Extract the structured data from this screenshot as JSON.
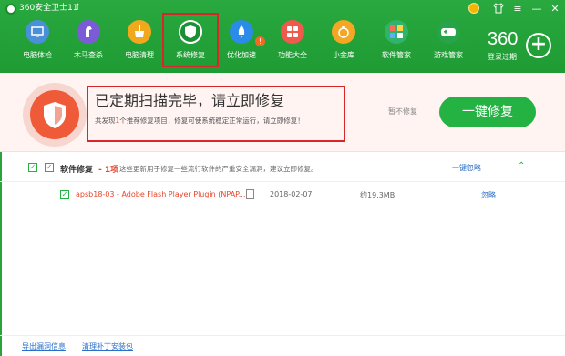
{
  "window": {
    "title": "360安全卫士11",
    "controls": [
      "shirt-icon",
      "menu-icon",
      "minimize-icon",
      "close-icon"
    ]
  },
  "nav": {
    "items": [
      {
        "label": "电脑体检",
        "icon": "monitor-icon",
        "color": "#4a90d9"
      },
      {
        "label": "木马查杀",
        "icon": "horse-icon",
        "color": "#7b5cd6"
      },
      {
        "label": "电脑清理",
        "icon": "broom-icon",
        "color": "#f0a81c"
      },
      {
        "label": "系统修复",
        "icon": "shield-icon",
        "color": "#1e9a3b"
      },
      {
        "label": "优化加速",
        "icon": "rocket-icon",
        "color": "#2b8be8"
      },
      {
        "label": "功能大全",
        "icon": "grid-icon",
        "color": "#ee5a4b"
      },
      {
        "label": "小金库",
        "icon": "coin-icon",
        "color": "#f5a623"
      },
      {
        "label": "软件管家",
        "icon": "apps-icon",
        "color": "#31b36b"
      },
      {
        "label": "游戏管家",
        "icon": "gamepad-icon",
        "color": "#27a34a"
      }
    ],
    "badge": "!",
    "brand": "360",
    "login_status": "登录过期"
  },
  "banner": {
    "title": "已定期扫描完毕，请立即修复",
    "subtitle_pre": "共发现",
    "subtitle_count": "1",
    "subtitle_post": "个推荐修复项目，修复可使系统稳定正常运行，请立即修复！",
    "ignore_label": "暂不修复",
    "fix_label": "一键修复"
  },
  "group": {
    "name": "软件修复",
    "count": "- 1项",
    "description": "这些更新用于修复一些流行软件的严重安全漏洞，建议立即修复。",
    "fix_label": "一键忽略",
    "toggle": "^"
  },
  "patch": {
    "name": "apsb18-03 - Adobe Flash Player Plugin (NPAP...",
    "date": "2018-02-07",
    "size": "约19.3MB",
    "action": "忽略"
  },
  "footer": {
    "export_label": "导出漏洞信息",
    "clean_label": "清理补丁安装包"
  }
}
